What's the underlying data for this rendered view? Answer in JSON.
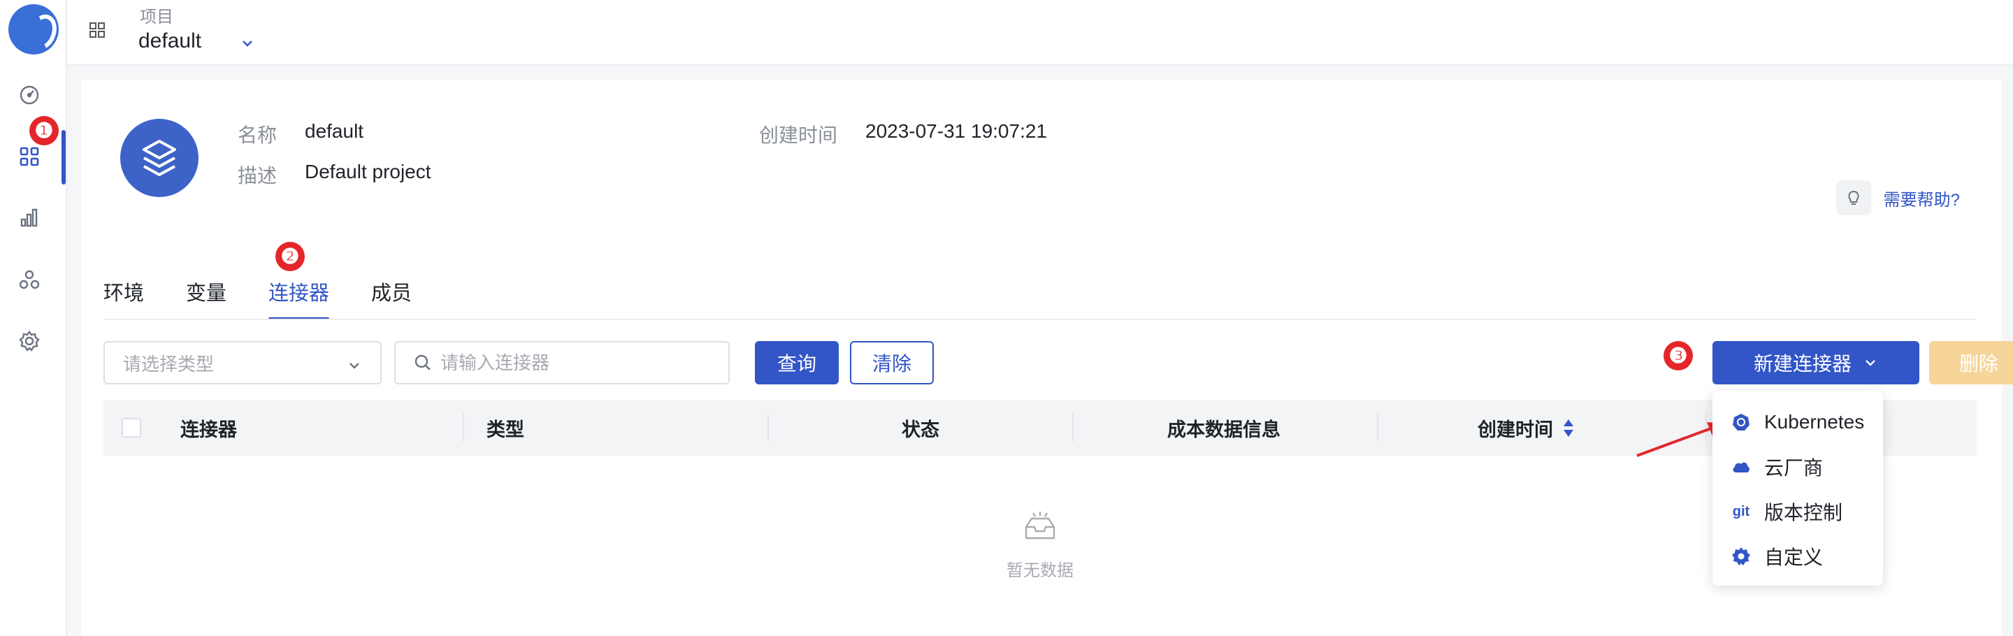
{
  "header": {
    "project_label": "项目",
    "project_value": "default"
  },
  "project": {
    "name_label": "名称",
    "name_value": "default",
    "desc_label": "描述",
    "desc_value": "Default project",
    "created_label": "创建时间",
    "created_value": "2023-07-31 19:07:21",
    "help_text": "需要帮助?"
  },
  "tabs": [
    {
      "label": "环境"
    },
    {
      "label": "变量"
    },
    {
      "label": "连接器",
      "active": true
    },
    {
      "label": "成员"
    }
  ],
  "toolbar": {
    "type_placeholder": "请选择类型",
    "search_placeholder": "请输入连接器",
    "query_label": "查询",
    "clear_label": "清除",
    "new_label": "新建连接器",
    "delete_label": "删除"
  },
  "table": {
    "columns": [
      "连接器",
      "类型",
      "状态",
      "成本数据信息",
      "创建时间"
    ],
    "empty_text": "暂无数据"
  },
  "dropdown": {
    "items": [
      {
        "label": "Kubernetes",
        "icon": "kubernetes-icon"
      },
      {
        "label": "云厂商",
        "icon": "cloud-icon"
      },
      {
        "label": "版本控制",
        "icon": "git-icon",
        "icon_text": "git"
      },
      {
        "label": "自定义",
        "icon": "gear-icon"
      }
    ]
  },
  "annotations": [
    "❶",
    "❷",
    "❸"
  ],
  "colors": {
    "primary": "#3255c7",
    "danger_mark": "#e4262a",
    "disabled_delete": "#f7d59a"
  }
}
